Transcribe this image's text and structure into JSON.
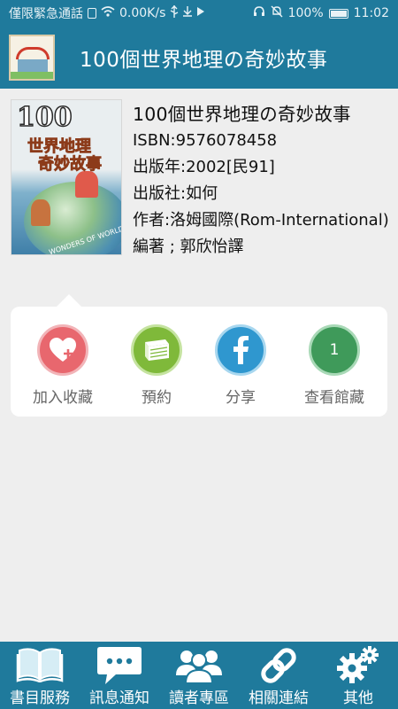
{
  "status_bar": {
    "carrier": "僅限緊急通話",
    "speed": "0.00K/s",
    "battery": "100%",
    "time": "11:02"
  },
  "app_bar": {
    "title": "100個世界地理の奇妙故事",
    "logo_icon": "library-building-logo"
  },
  "book": {
    "title": "100個世界地理の奇妙故事",
    "isbn": "ISBN:9576078458",
    "year": "出版年:2002[民91]",
    "publisher": "出版社:如何",
    "author": "作者:洛姆國際(Rom-International)編著 ; 郭欣怡譯",
    "cover": {
      "number": "100",
      "title_line1": "世界地理",
      "title_line2": "奇妙故事",
      "banner": "WONDERS OF WORLD 地理"
    }
  },
  "actions": [
    {
      "label": "加入收藏",
      "icon": "heart-plus-icon",
      "color": "#e8676e"
    },
    {
      "label": "預約",
      "icon": "book-icon",
      "color": "#7fb93a"
    },
    {
      "label": "分享",
      "icon": "facebook-icon",
      "color": "#2f97cf"
    },
    {
      "label": "查看館藏",
      "icon": "holdings-count-icon",
      "color": "#3f9a5a",
      "count": "1"
    }
  ],
  "bottom_nav": [
    {
      "label": "書目服務",
      "icon": "open-book-icon"
    },
    {
      "label": "訊息通知",
      "icon": "chat-bubble-icon"
    },
    {
      "label": "讀者專區",
      "icon": "users-icon"
    },
    {
      "label": "相關連結",
      "icon": "link-icon"
    },
    {
      "label": "其他",
      "icon": "gears-icon"
    }
  ],
  "colors": {
    "primary": "#1f7a9c",
    "background": "#eeeeee",
    "card": "#ffffff"
  }
}
